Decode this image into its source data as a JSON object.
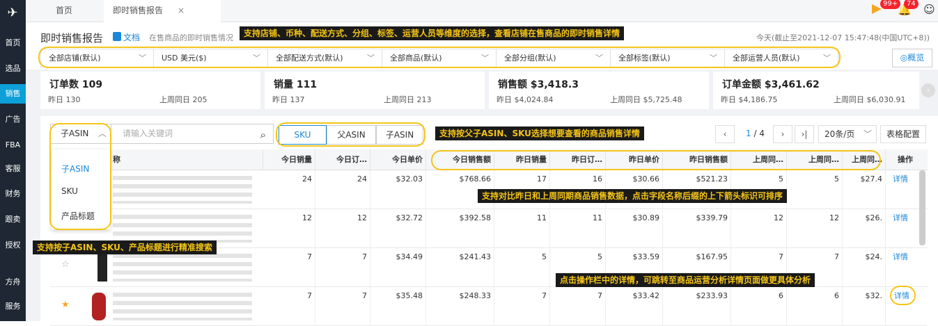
{
  "sidebar": {
    "items": [
      "首页",
      "选品",
      "销售",
      "广告",
      "FBA",
      "客服",
      "财务",
      "跟卖",
      "授权",
      "方舟",
      "服务"
    ],
    "active": 2
  },
  "tabs": {
    "home": "首页",
    "current": "即时销售报告",
    "close": "×"
  },
  "header": {
    "notif_count": "99+",
    "alert_count": "74"
  },
  "page": {
    "title": "即时销售报告",
    "doc": "文档",
    "desc": "在售商品的即时销售情况",
    "date": "今天(截止至2021-12-07 15:47:48(中国UTC+8))"
  },
  "annotations": {
    "filters": "支持店铺、币种、配送方式、分组、标签、运营人员等维度的选择，查看店铺在售商品的即时销售详情",
    "asin": "支持按父子ASIN、SKU选择想要查看的商品销售详情",
    "compare": "支持对比昨日和上周同期商品销售数据，点击字段名称后缀的上下箭头标识可排序",
    "search": "支持按子ASIN、SKU、产品标题进行精准搜索",
    "detail": "点击操作栏中的详情，可跳转至商品运营分析详情页面做更具体分析"
  },
  "filters": [
    "全部店铺(默认)",
    "USD  美元($)",
    "全部配送方式(默认)",
    "全部商品(默认)",
    "全部分组(默认)",
    "全部标签(默认)",
    "全部运营人员(默认)"
  ],
  "overview": "概览",
  "stats": [
    {
      "title": "订单数 109",
      "yday": "昨日 130",
      "lw": "上周同日 205"
    },
    {
      "title": "销量 111",
      "yday": "昨日 137",
      "lw": "上周同日 213"
    },
    {
      "title": "销售额 $3,418.3",
      "yday": "昨日 $4,024.84",
      "lw": "上周同日 $5,725.48"
    },
    {
      "title": "订单金额 $3,461.62",
      "yday": "昨日 $4,186.75",
      "lw": "上周同日 $6,030.91"
    }
  ],
  "search": {
    "select": "子ASIN",
    "placeholder": "请输入关键词"
  },
  "segments": [
    "SKU",
    "父ASIN",
    "子ASIN"
  ],
  "pagination": {
    "current": "1",
    "total": "/ 4",
    "size": "20条/页",
    "config": "表格配置"
  },
  "dropdown": [
    "子ASIN",
    "SKU",
    "产品标题"
  ],
  "columns": [
    "称",
    "今日销量",
    "今日订…",
    "今日单价",
    "今日销售额",
    "昨日销量",
    "昨日订…",
    "昨日单价",
    "昨日销售额",
    "上周同…",
    "上周同…",
    "上周同…",
    "操作"
  ],
  "rows": [
    [
      "24",
      "24",
      "$32.03",
      "$768.66",
      "17",
      "16",
      "$30.66",
      "$521.23",
      "5",
      "5",
      "$27.4",
      "详情"
    ],
    [
      "12",
      "12",
      "$32.72",
      "$392.58",
      "11",
      "11",
      "$30.89",
      "$339.79",
      "12",
      "12",
      "$26.",
      "详情"
    ],
    [
      "7",
      "7",
      "$34.49",
      "$241.43",
      "5",
      "5",
      "$33.59",
      "$167.95",
      "7",
      "7",
      "$24.",
      "详情"
    ],
    [
      "7",
      "7",
      "$35.48",
      "$248.33",
      "7",
      "7",
      "$33.42",
      "$233.93",
      "6",
      "6",
      "$32.",
      "详情"
    ]
  ]
}
